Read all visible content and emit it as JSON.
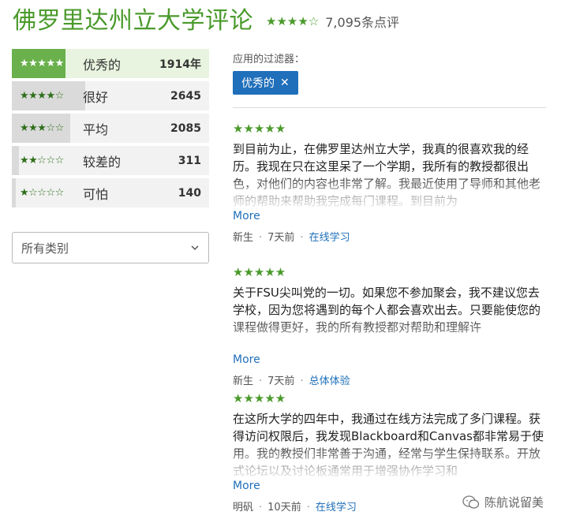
{
  "header": {
    "title": "佛罗里达州立大学评论",
    "stars": "★★★★☆",
    "review_count": "7,095条点评"
  },
  "rating_bars": [
    {
      "stars": "★★★★★",
      "label": "优秀的",
      "count": "1914年",
      "fraction": 0.27
    },
    {
      "stars": "★★★★☆",
      "label": "很好",
      "count": "2645",
      "fraction": 0.37
    },
    {
      "stars": "★★★☆☆",
      "label": "平均",
      "count": "2085",
      "fraction": 0.29
    },
    {
      "stars": "★★☆☆☆",
      "label": "较差的",
      "count": "311",
      "fraction": 0.04
    },
    {
      "stars": "★☆☆☆☆",
      "label": "可怕",
      "count": "140",
      "fraction": 0.02
    }
  ],
  "category_select": {
    "value": "所有类别"
  },
  "filters": {
    "label": "应用的过滤器：",
    "chips": [
      {
        "label": "优秀的",
        "remove": "✕"
      }
    ]
  },
  "reviews": [
    {
      "stars": "★★★★★",
      "text": "到目前为止，在佛罗里达州立大学，我真的很喜欢我的经历。我现在只在这里呆了一个学期，我所有的教授都很出色，对他们的内容也非常了解。我最近使用了导师和其他老师的帮助来帮助我完成每门课程。到目前为",
      "more": "More",
      "author": "新生",
      "time": "7天前",
      "category": "在线学习"
    },
    {
      "stars": "★★★★★",
      "text": "关于FSU尖叫党的一切。如果您不参加聚会，我不建议您去学校，因为您将遇到的每个人都会喜欢出去。只要能使您的课程做得更好，我的所有教授都对帮助和理解许",
      "more": "More",
      "author": "新生",
      "time": "7天前",
      "category": "总体体验"
    },
    {
      "stars": "★★★★★",
      "text": "在这所大学的四年中，我通过在线方法完成了多门课程。获得访问权限后，我发现Blackboard和Canvas都非常易于使用。我的教授们非常善于沟通，经常与学生保持联系。开放式论坛以及讨论板通常用于增强协作学习和",
      "more": "More",
      "author": "明矾",
      "time": "10天前",
      "category": "在线学习"
    }
  ],
  "watermark": {
    "text": "陈航说留美"
  }
}
